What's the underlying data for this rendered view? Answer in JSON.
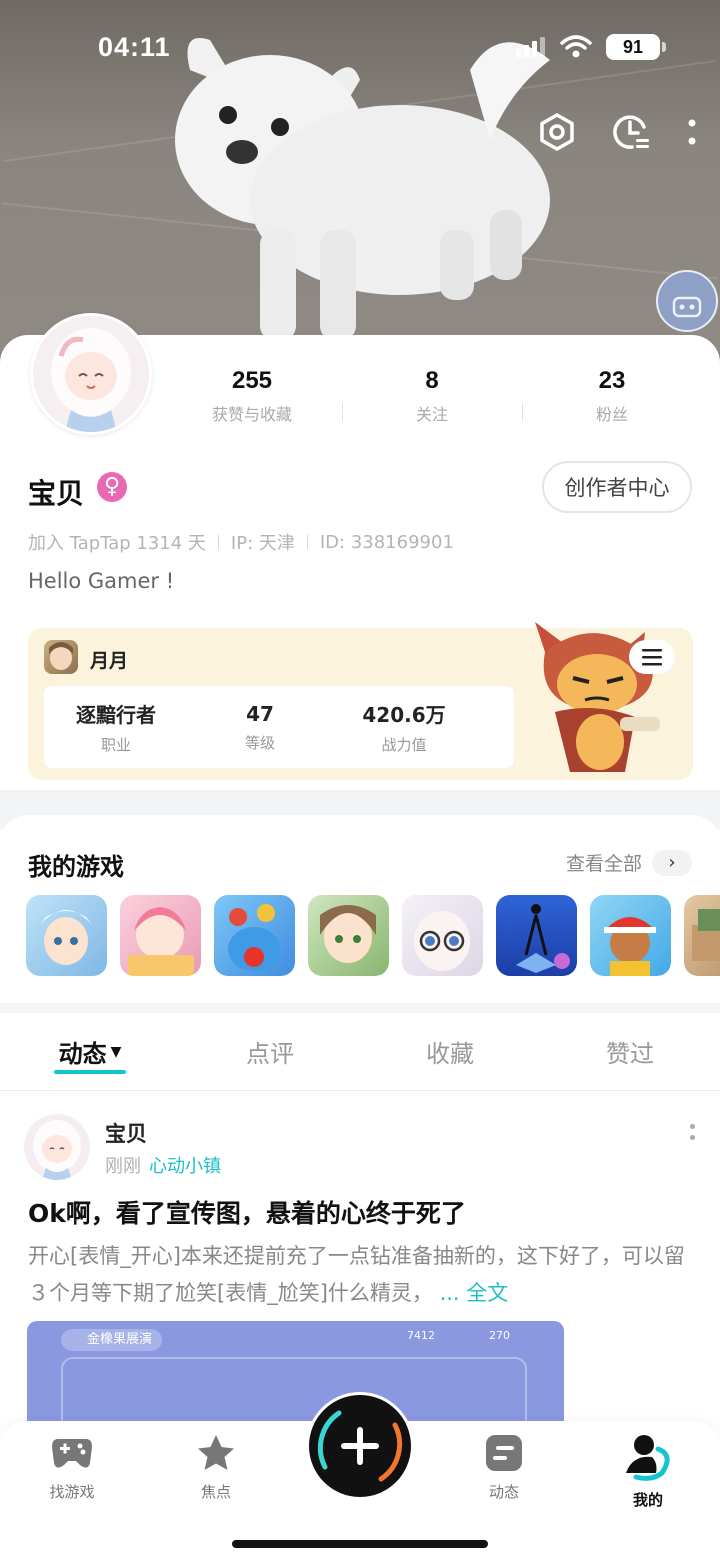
{
  "status_bar": {
    "time": "04:11",
    "battery": "91"
  },
  "profile": {
    "stats": [
      {
        "value": "255",
        "label": "获赞与收藏"
      },
      {
        "value": "8",
        "label": "关注"
      },
      {
        "value": "23",
        "label": "粉丝"
      }
    ],
    "name": "宝贝",
    "gender_symbol": "♀",
    "creator_center": "创作者中心",
    "join_text": "加入 TapTap 1314 天",
    "ip_text": "IP: 天津",
    "id_text": "ID: 338169901",
    "bio": "Hello Gamer !"
  },
  "game_card": {
    "title": "月月",
    "stats": [
      {
        "value": "逐黯行者",
        "label": "职业"
      },
      {
        "value": "47",
        "label": "等级"
      },
      {
        "value": "420.6万",
        "label": "战力值"
      }
    ]
  },
  "my_games": {
    "title": "我的游戏",
    "see_all": "查看全部",
    "tiles": [
      "game-1-icon",
      "game-2-icon",
      "game-3-icon",
      "game-4-icon",
      "game-5-icon",
      "game-6-icon",
      "game-7-icon",
      "game-8-icon"
    ]
  },
  "tabs": [
    {
      "label": "动态",
      "active": true
    },
    {
      "label": "点评"
    },
    {
      "label": "收藏"
    },
    {
      "label": "赞过"
    }
  ],
  "post": {
    "author": "宝贝",
    "time": "刚刚",
    "tag": "心动小镇",
    "title": "Ok啊，看了宣传图，悬着的心终于死了",
    "body": "开心[表情_开心]本来还提前充了一点钻准备抽新的，这下好了，可以留３个月等下期了尬笑[表情_尬笑]什么精灵，",
    "more": "... 全文",
    "image_chip": "金橡果展演",
    "image_num1": "7412",
    "image_num2": "270"
  },
  "bottom_nav": [
    {
      "label": "找游戏"
    },
    {
      "label": "焦点"
    },
    {
      "label": "动态"
    },
    {
      "label": "我的",
      "active": true
    }
  ],
  "colors": {
    "accent": "#15c5ce",
    "gender": "#e76bb4",
    "card_bg": "#fbf3dc"
  }
}
